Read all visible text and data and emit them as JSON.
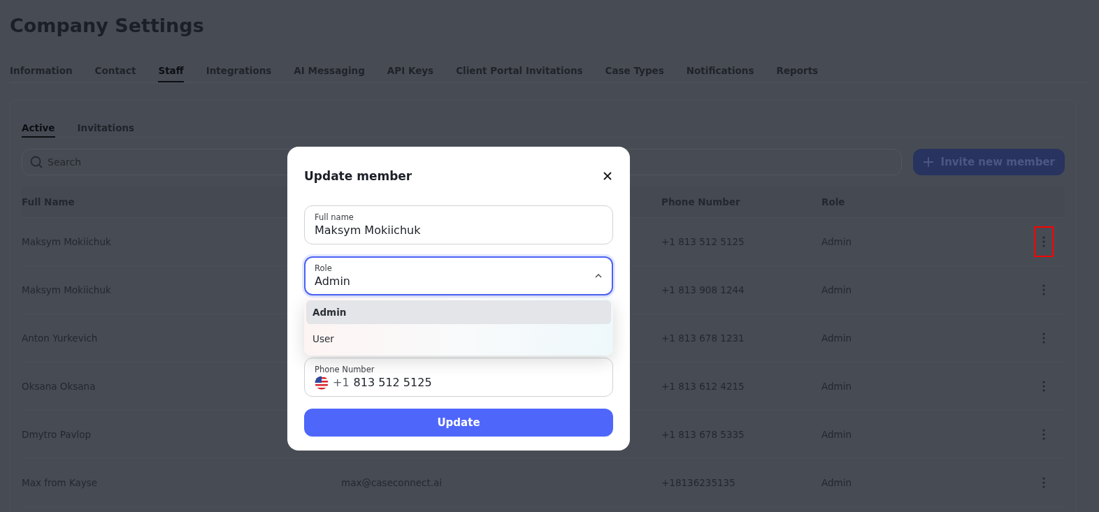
{
  "page": {
    "title": "Company Settings"
  },
  "tabs": [
    {
      "label": "Information",
      "selected": false
    },
    {
      "label": "Contact",
      "selected": false
    },
    {
      "label": "Staff",
      "selected": true
    },
    {
      "label": "Integrations",
      "selected": false
    },
    {
      "label": "AI Messaging",
      "selected": false
    },
    {
      "label": "API Keys",
      "selected": false
    },
    {
      "label": "Client Portal Invitations",
      "selected": false
    },
    {
      "label": "Case Types",
      "selected": false
    },
    {
      "label": "Notifications",
      "selected": false
    },
    {
      "label": "Reports",
      "selected": false
    }
  ],
  "subtabs": [
    {
      "label": "Active",
      "selected": true
    },
    {
      "label": "Invitations",
      "selected": false
    }
  ],
  "search": {
    "placeholder": "Search"
  },
  "invite_button": {
    "label": "Invite new member"
  },
  "table": {
    "columns": {
      "name": "Full Name",
      "phone": "Phone Number",
      "role": "Role"
    },
    "rows": [
      {
        "name": "Maksym Mokiichuk",
        "phone": "+1 813 512 5125",
        "role": "Admin",
        "highlighted": true
      },
      {
        "name": "Maksym Mokiichuk",
        "phone": "+1 813 908 1244",
        "role": "Admin",
        "highlighted": false
      },
      {
        "name": "Anton Yurkevich",
        "phone": "+1 813 678 1231",
        "role": "Admin",
        "highlighted": false
      },
      {
        "name": "Oksana Oksana",
        "phone": "+1 813 612 4215",
        "role": "Admin",
        "highlighted": false
      },
      {
        "name": "Dmytro Pavlop",
        "phone": "+1 813 678 5335",
        "role": "Admin",
        "highlighted": false
      },
      {
        "name": "Max from Kayse",
        "email": "max@caseconnect.ai",
        "phone": "+18136235135",
        "role": "Admin",
        "highlighted": false
      }
    ]
  },
  "modal": {
    "title": "Update member",
    "fields": [
      {
        "kind": "text",
        "label": "Full name",
        "value": "Maksym Mokiichuk"
      },
      {
        "kind": "select",
        "label": "Role",
        "value": "Admin",
        "expanded": true,
        "options": [
          {
            "label": "Admin",
            "selected": true
          },
          {
            "label": "User",
            "selected": false
          }
        ]
      },
      {
        "kind": "phone",
        "label": "Phone Number",
        "code": "+1",
        "value": "813 512 5125"
      }
    ],
    "button": "Update"
  }
}
